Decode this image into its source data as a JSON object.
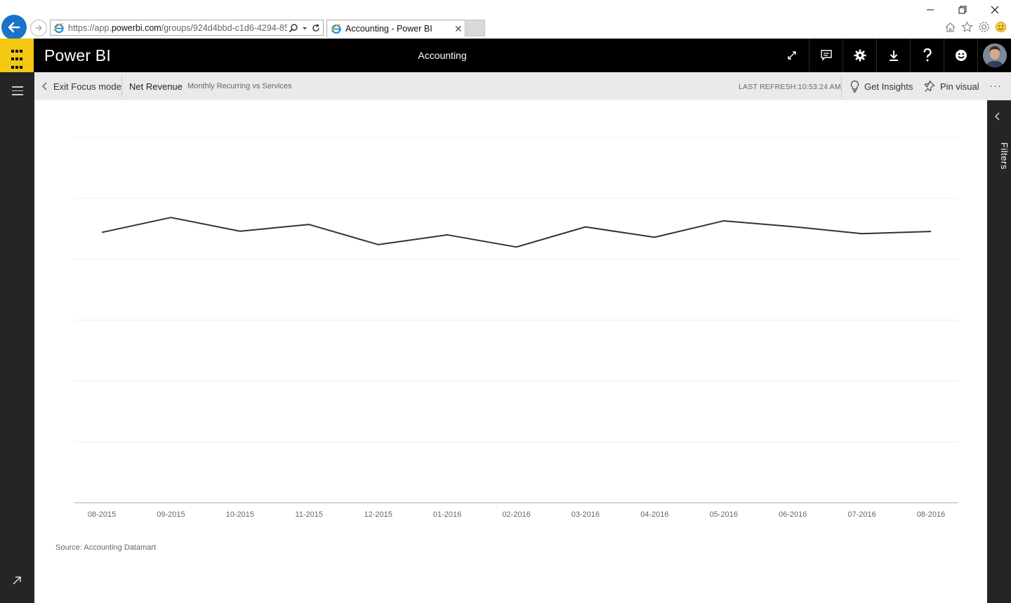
{
  "browser": {
    "url_prefix": "https://app.",
    "url_domain": "powerbi.com",
    "url_rest": "/groups/924d4bbd-c1d6-4294-85",
    "tab_title": "Accounting - Power BI",
    "tab_close": "✕"
  },
  "header": {
    "brand": "Power BI",
    "title": "Accounting"
  },
  "toolbar": {
    "exit_focus": "Exit Focus mode",
    "visual_title": "Net Revenue",
    "visual_subtitle": "Monthly Recurring vs Services",
    "last_refresh": "LAST REFRESH:10:53:24 AM",
    "get_insights": "Get Insights",
    "pin_visual": "Pin visual",
    "more": "···"
  },
  "filters": {
    "label": "Filters"
  },
  "chart_data": {
    "type": "line",
    "title": "",
    "xlabel": "",
    "ylabel": "",
    "categories": [
      "08-2015",
      "09-2015",
      "10-2015",
      "11-2015",
      "12-2015",
      "01-2016",
      "02-2016",
      "03-2016",
      "04-2016",
      "05-2016",
      "06-2016",
      "07-2016",
      "08-2016"
    ],
    "series": [
      {
        "values": [
          0.888,
          0.937,
          0.892,
          0.914,
          0.848,
          0.88,
          0.84,
          0.906,
          0.872,
          0.926,
          0.907,
          0.884,
          0.891
        ]
      }
    ],
    "ylim": [
      0,
      1.2
    ],
    "grid": true,
    "gridlines": 6,
    "color": "#333333",
    "source": "Source: Accounting Datamart"
  },
  "colors": {
    "accent": "#f2c811",
    "header_bg": "#000000",
    "nav_bg": "#252525",
    "toolbar_bg": "#eaeaea",
    "browser_back": "#1a73c8"
  }
}
